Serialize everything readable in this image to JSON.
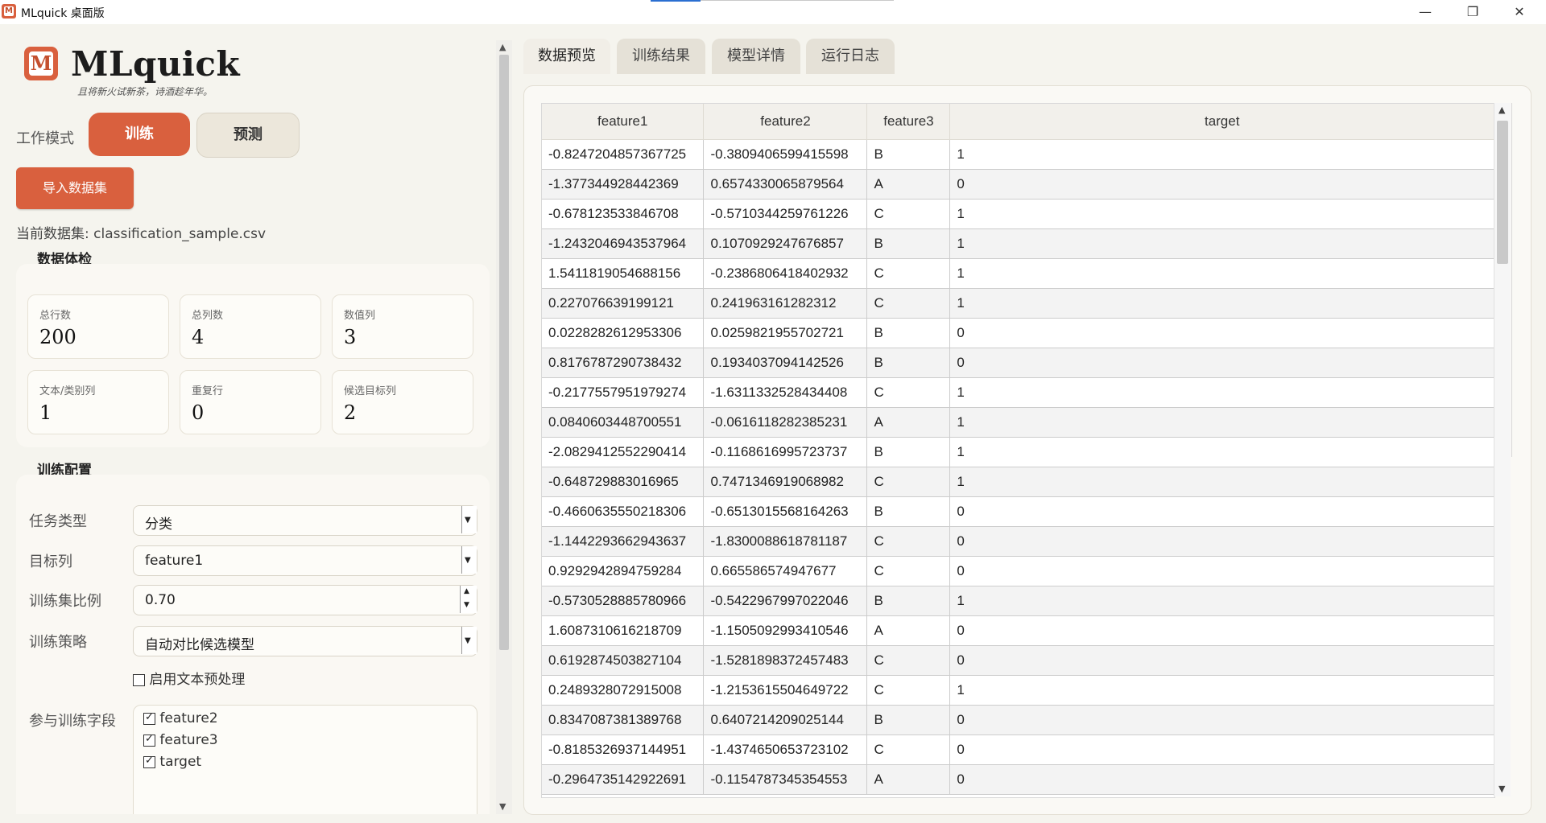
{
  "window": {
    "title": "MLquick 桌面版",
    "minimize_glyph": "—",
    "restore_glyph": "❐",
    "close_glyph": "✕"
  },
  "brand": {
    "logo_letter": "M",
    "name": "MLquick",
    "tagline": "且将新火试新茶，诗酒趁年华。"
  },
  "mode": {
    "label": "工作模式",
    "train_label": "训练",
    "predict_label": "预测",
    "active": "train"
  },
  "import_button": "导入数据集",
  "dataset_line": "当前数据集: classification_sample.csv",
  "health_check": {
    "title": "数据体检",
    "stats": [
      {
        "label": "总行数",
        "value": "200"
      },
      {
        "label": "总列数",
        "value": "4"
      },
      {
        "label": "数值列",
        "value": "3"
      },
      {
        "label": "文本/类别列",
        "value": "1"
      },
      {
        "label": "重复行",
        "value": "0"
      },
      {
        "label": "候选目标列",
        "value": "2"
      }
    ]
  },
  "training_config": {
    "title": "训练配置",
    "task_type": {
      "label": "任务类型",
      "value": "分类"
    },
    "target": {
      "label": "目标列",
      "value": "feature1"
    },
    "train_ratio": {
      "label": "训练集比例",
      "value": "0.70"
    },
    "strategy": {
      "label": "训练策略",
      "value": "自动对比候选模型"
    },
    "text_preprocess": {
      "label": "启用文本预处理",
      "checked": false
    },
    "fields": {
      "label": "参与训练字段",
      "items": [
        {
          "name": "feature2",
          "checked": true
        },
        {
          "name": "feature3",
          "checked": true
        },
        {
          "name": "target",
          "checked": true
        }
      ]
    }
  },
  "tabs": [
    {
      "label": "数据预览",
      "active": true
    },
    {
      "label": "训练结果",
      "active": false
    },
    {
      "label": "模型详情",
      "active": false
    },
    {
      "label": "运行日志",
      "active": false
    }
  ],
  "table": {
    "columns": [
      "feature1",
      "feature2",
      "feature3",
      "target"
    ],
    "rows": [
      [
        "-0.8247204857367725",
        "-0.3809406599415598",
        "B",
        "1"
      ],
      [
        "-1.377344928442369",
        "0.6574330065879564",
        "A",
        "0"
      ],
      [
        "-0.678123533846708",
        "-0.5710344259761226",
        "C",
        "1"
      ],
      [
        "-1.2432046943537964",
        "0.1070929247676857",
        "B",
        "1"
      ],
      [
        "1.5411819054688156",
        "-0.2386806418402932",
        "C",
        "1"
      ],
      [
        "0.227076639199121",
        "0.241963161282312",
        "C",
        "1"
      ],
      [
        "0.0228282612953306",
        "0.0259821955702721",
        "B",
        "0"
      ],
      [
        "0.8176787290738432",
        "0.1934037094142526",
        "B",
        "0"
      ],
      [
        "-0.2177557951979274",
        "-1.6311332528434408",
        "C",
        "1"
      ],
      [
        "0.0840603448700551",
        "-0.0616118282385231",
        "A",
        "1"
      ],
      [
        "-2.0829412552290414",
        "-0.1168616995723737",
        "B",
        "1"
      ],
      [
        "-0.648729883016965",
        "0.7471346919068982",
        "C",
        "1"
      ],
      [
        "-0.4660635550218306",
        "-0.6513015568164263",
        "B",
        "0"
      ],
      [
        "-1.1442293662943637",
        "-1.8300088618781187",
        "C",
        "0"
      ],
      [
        "0.9292942894759284",
        "0.665586574947677",
        "C",
        "0"
      ],
      [
        "-0.5730528885780966",
        "-0.5422967997022046",
        "B",
        "1"
      ],
      [
        "1.6087310616218709",
        "-1.1505092993410546",
        "A",
        "0"
      ],
      [
        "0.6192874503827104",
        "-1.5281898372457483",
        "C",
        "0"
      ],
      [
        "0.2489328072915008",
        "-1.2153615504649722",
        "C",
        "1"
      ],
      [
        "0.8347087381389768",
        "0.6407214209025144",
        "B",
        "0"
      ],
      [
        "-0.8185326937144951",
        "-1.4374650653723102",
        "C",
        "0"
      ],
      [
        "-0.2964735142922691",
        "-0.1154787345354553",
        "A",
        "0"
      ]
    ]
  }
}
